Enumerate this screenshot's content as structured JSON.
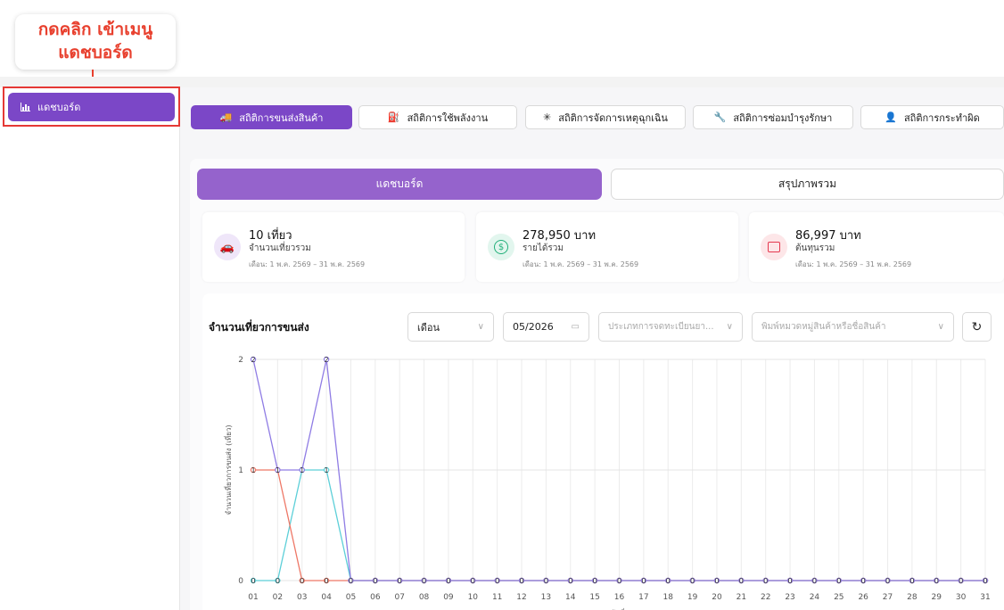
{
  "annotation": {
    "line1": "กดคลิก เข้าเมนู",
    "line2": "แดชบอร์ด"
  },
  "sidebar": {
    "items": [
      {
        "label": "แดชบอร์ด",
        "icon": "bar-chart-icon"
      }
    ]
  },
  "top_tabs": [
    {
      "label": "สถิติการขนส่งสินค้า",
      "icon": "truck-icon",
      "active": true
    },
    {
      "label": "สถิติการใช้พลังงาน",
      "icon": "fuel-icon",
      "active": false
    },
    {
      "label": "สถิติการจัดการเหตุฉุกเฉิน",
      "icon": "alert-icon",
      "active": false
    },
    {
      "label": "สถิติการซ่อมบำรุงรักษา",
      "icon": "wrench-icon",
      "active": false
    },
    {
      "label": "สถิติการกระทำผิด",
      "icon": "person-icon",
      "active": false
    }
  ],
  "sub_tabs": [
    {
      "label": "แดชบอร์ด",
      "active": true
    },
    {
      "label": "สรุปภาพรวม",
      "active": false
    }
  ],
  "stats": [
    {
      "value": "10 เที่ยว",
      "label": "จำนวนเที่ยวรวม",
      "range": "เดือน: 1 พ.ค. 2569 – 31 พ.ค. 2569",
      "icon": "car-icon",
      "color": "#7b47c7",
      "bg": "#efe6f9"
    },
    {
      "value": "278,950 บาท",
      "label": "รายได้รวม",
      "range": "เดือน: 1 พ.ค. 2569 – 31 พ.ค. 2569",
      "icon": "dollar-icon",
      "color": "#22b07a",
      "bg": "#e2f6ee"
    },
    {
      "value": "86,997 บาท",
      "label": "ต้นทุนรวม",
      "range": "เดือน: 1 พ.ค. 2569 – 31 พ.ค. 2569",
      "icon": "wallet-icon",
      "color": "#e53950",
      "bg": "#fde6e8"
    }
  ],
  "chart_section": {
    "title": "จำนวนเที่ยวการขนส่ง",
    "period_select": "เดือน",
    "month_value": "05/2026",
    "vehicle_type_placeholder": "ประเภทการจดทะเบียนยา...",
    "product_placeholder": "พิมพ์หมวดหมู่สินค้าหรือชื่อสินค้า"
  },
  "chart_data": {
    "type": "line",
    "ylabel": "จำนวนเที่ยวการขนส่ง (เที่ยว)",
    "xlabel": "วันที่",
    "ylim": [
      0,
      2
    ],
    "y_ticks": [
      "0",
      "1",
      "2"
    ],
    "grid": true,
    "categories": [
      "01",
      "02",
      "03",
      "04",
      "05",
      "06",
      "07",
      "08",
      "09",
      "10",
      "11",
      "12",
      "13",
      "14",
      "15",
      "16",
      "17",
      "18",
      "19",
      "20",
      "21",
      "22",
      "23",
      "24",
      "25",
      "26",
      "27",
      "28",
      "29",
      "30",
      "31"
    ],
    "series": [
      {
        "color": "#8f7ce4",
        "values": [
          2,
          1,
          1,
          2,
          0,
          0,
          0,
          0,
          0,
          0,
          0,
          0,
          0,
          0,
          0,
          0,
          0,
          0,
          0,
          0,
          0,
          0,
          0,
          0,
          0,
          0,
          0,
          0,
          0,
          0,
          0
        ]
      },
      {
        "color": "#ee7766",
        "values": [
          1,
          1,
          0,
          0,
          0,
          0,
          0,
          0,
          0,
          0,
          0,
          0,
          0,
          0,
          0,
          0,
          0,
          0,
          0,
          0,
          0,
          0,
          0,
          0,
          0,
          0,
          0,
          0,
          0,
          0,
          0
        ]
      },
      {
        "color": "#5ccfd8",
        "values": [
          0,
          0,
          1,
          1,
          0,
          0,
          0,
          0,
          0,
          0,
          0,
          0,
          0,
          0,
          0,
          0,
          0,
          0,
          0,
          0,
          0,
          0,
          0,
          0,
          0,
          0,
          0,
          0,
          0,
          0,
          0
        ]
      }
    ],
    "point_labels": [
      {
        "x": "01",
        "text": "2"
      },
      {
        "x": "04",
        "text": "2"
      },
      {
        "x": "01",
        "text": "1"
      },
      {
        "x": "02",
        "text": "1"
      },
      {
        "x": "03",
        "text": "1"
      },
      {
        "x": "04",
        "text": "1"
      },
      {
        "x": "01",
        "text": "0"
      },
      {
        "x": "02",
        "text": "0"
      },
      {
        "x": "03",
        "text": "0"
      },
      {
        "x": "04",
        "text": "0"
      },
      {
        "x": "05",
        "text": "0"
      },
      {
        "x": "06",
        "text": "0"
      },
      {
        "x": "07",
        "text": "0"
      },
      {
        "x": "08",
        "text": "0"
      },
      {
        "x": "09",
        "text": "0"
      },
      {
        "x": "10",
        "text": "0"
      },
      {
        "x": "11",
        "text": "0"
      },
      {
        "x": "12",
        "text": "0"
      },
      {
        "x": "13",
        "text": "0"
      },
      {
        "x": "14",
        "text": "0"
      },
      {
        "x": "15",
        "text": "0"
      },
      {
        "x": "16",
        "text": "0"
      },
      {
        "x": "17",
        "text": "0"
      },
      {
        "x": "18",
        "text": "0"
      },
      {
        "x": "19",
        "text": "0"
      },
      {
        "x": "20",
        "text": "0"
      },
      {
        "x": "21",
        "text": "0"
      },
      {
        "x": "22",
        "text": "0"
      },
      {
        "x": "23",
        "text": "0"
      },
      {
        "x": "24",
        "text": "0"
      },
      {
        "x": "25",
        "text": "0"
      },
      {
        "x": "26",
        "text": "0"
      },
      {
        "x": "27",
        "text": "0"
      },
      {
        "x": "28",
        "text": "0"
      },
      {
        "x": "29",
        "text": "0"
      },
      {
        "x": "30",
        "text": "0"
      },
      {
        "x": "31",
        "text": "0"
      }
    ]
  }
}
